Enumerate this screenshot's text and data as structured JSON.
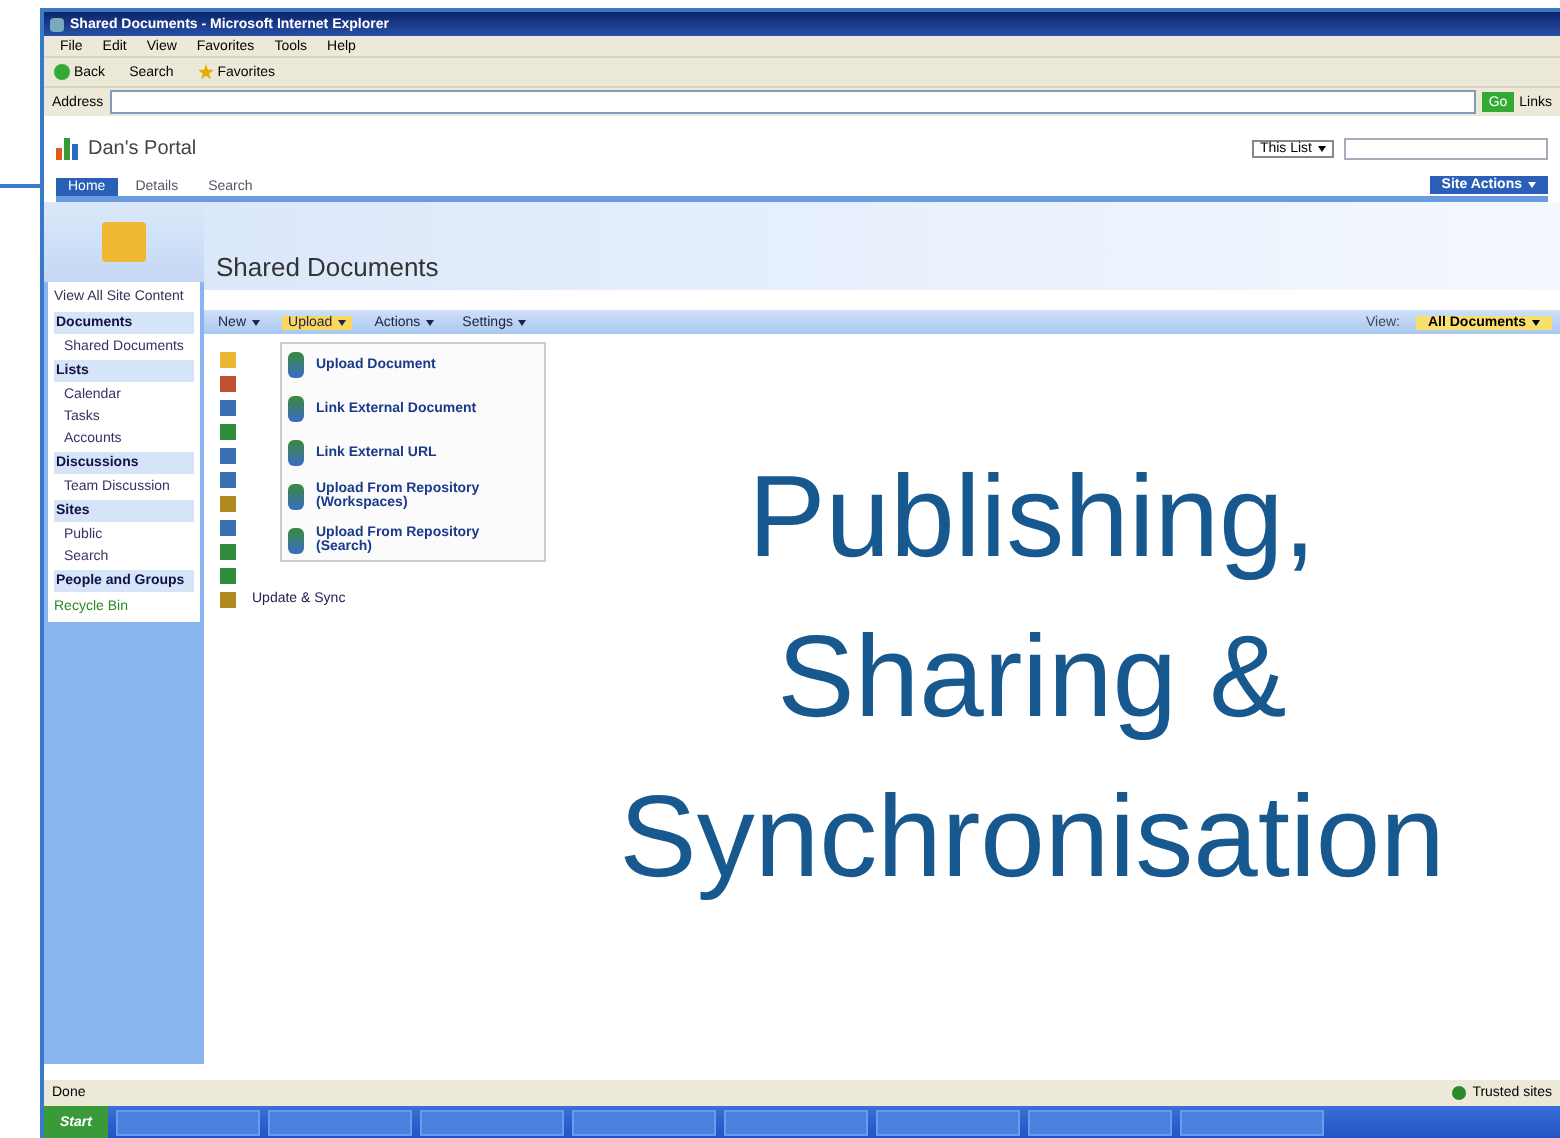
{
  "window": {
    "title": "Shared Documents - Microsoft Internet Explorer"
  },
  "menu": [
    "File",
    "Edit",
    "View",
    "Favorites",
    "Tools",
    "Help"
  ],
  "toolbar": {
    "back": "Back",
    "search": "Search",
    "favorites": "Favorites"
  },
  "address": {
    "label": "Address",
    "go": "Go",
    "links": "Links"
  },
  "portal": {
    "title": "Dan's Portal",
    "tabs": [
      {
        "label": "Home",
        "selected": true
      },
      {
        "label": "Details",
        "selected": false
      },
      {
        "label": "Search",
        "selected": false
      }
    ],
    "site_actions": "Site Actions",
    "scope": "This List"
  },
  "page": {
    "title": "Shared Documents"
  },
  "sidebar": {
    "view_all": "View All Site Content",
    "sections": [
      {
        "heading": "Documents",
        "items": [
          "Shared Documents"
        ]
      },
      {
        "heading": "Lists",
        "items": [
          "Calendar",
          "Tasks",
          "Accounts"
        ]
      },
      {
        "heading": "Discussions",
        "items": [
          "Team Discussion"
        ]
      },
      {
        "heading": "Sites",
        "items": [
          "Public",
          "Search"
        ]
      },
      {
        "heading": "People and Groups"
      }
    ],
    "recycle_bin": "Recycle Bin"
  },
  "list_toolbar": {
    "buttons": [
      {
        "label": "New",
        "selected": false
      },
      {
        "label": "Upload",
        "selected": true
      },
      {
        "label": "Actions",
        "selected": false
      },
      {
        "label": "Settings",
        "selected": false
      }
    ],
    "view_label": "View:",
    "view": "All Documents"
  },
  "upload_menu": [
    "Upload Document",
    "Link External Document",
    "Link External URL",
    "Upload From Repository (Workspaces)",
    "Upload From Repository (Search)"
  ],
  "rows": [
    {
      "kind": "folder"
    },
    {
      "kind": "image"
    },
    {
      "kind": "doc"
    },
    {
      "kind": "sheet"
    },
    {
      "kind": "doc"
    },
    {
      "kind": "doc"
    },
    {
      "kind": "edit"
    },
    {
      "kind": "doc"
    },
    {
      "kind": "sheet"
    },
    {
      "kind": "sheet"
    },
    {
      "kind": "edit",
      "name": "Update & Sync"
    }
  ],
  "overlay": [
    "Publishing,",
    "Sharing &",
    "Synchronisation"
  ],
  "status_bar": {
    "left": "Done",
    "right": "Trusted sites"
  },
  "taskbar": {
    "start": "Start"
  }
}
